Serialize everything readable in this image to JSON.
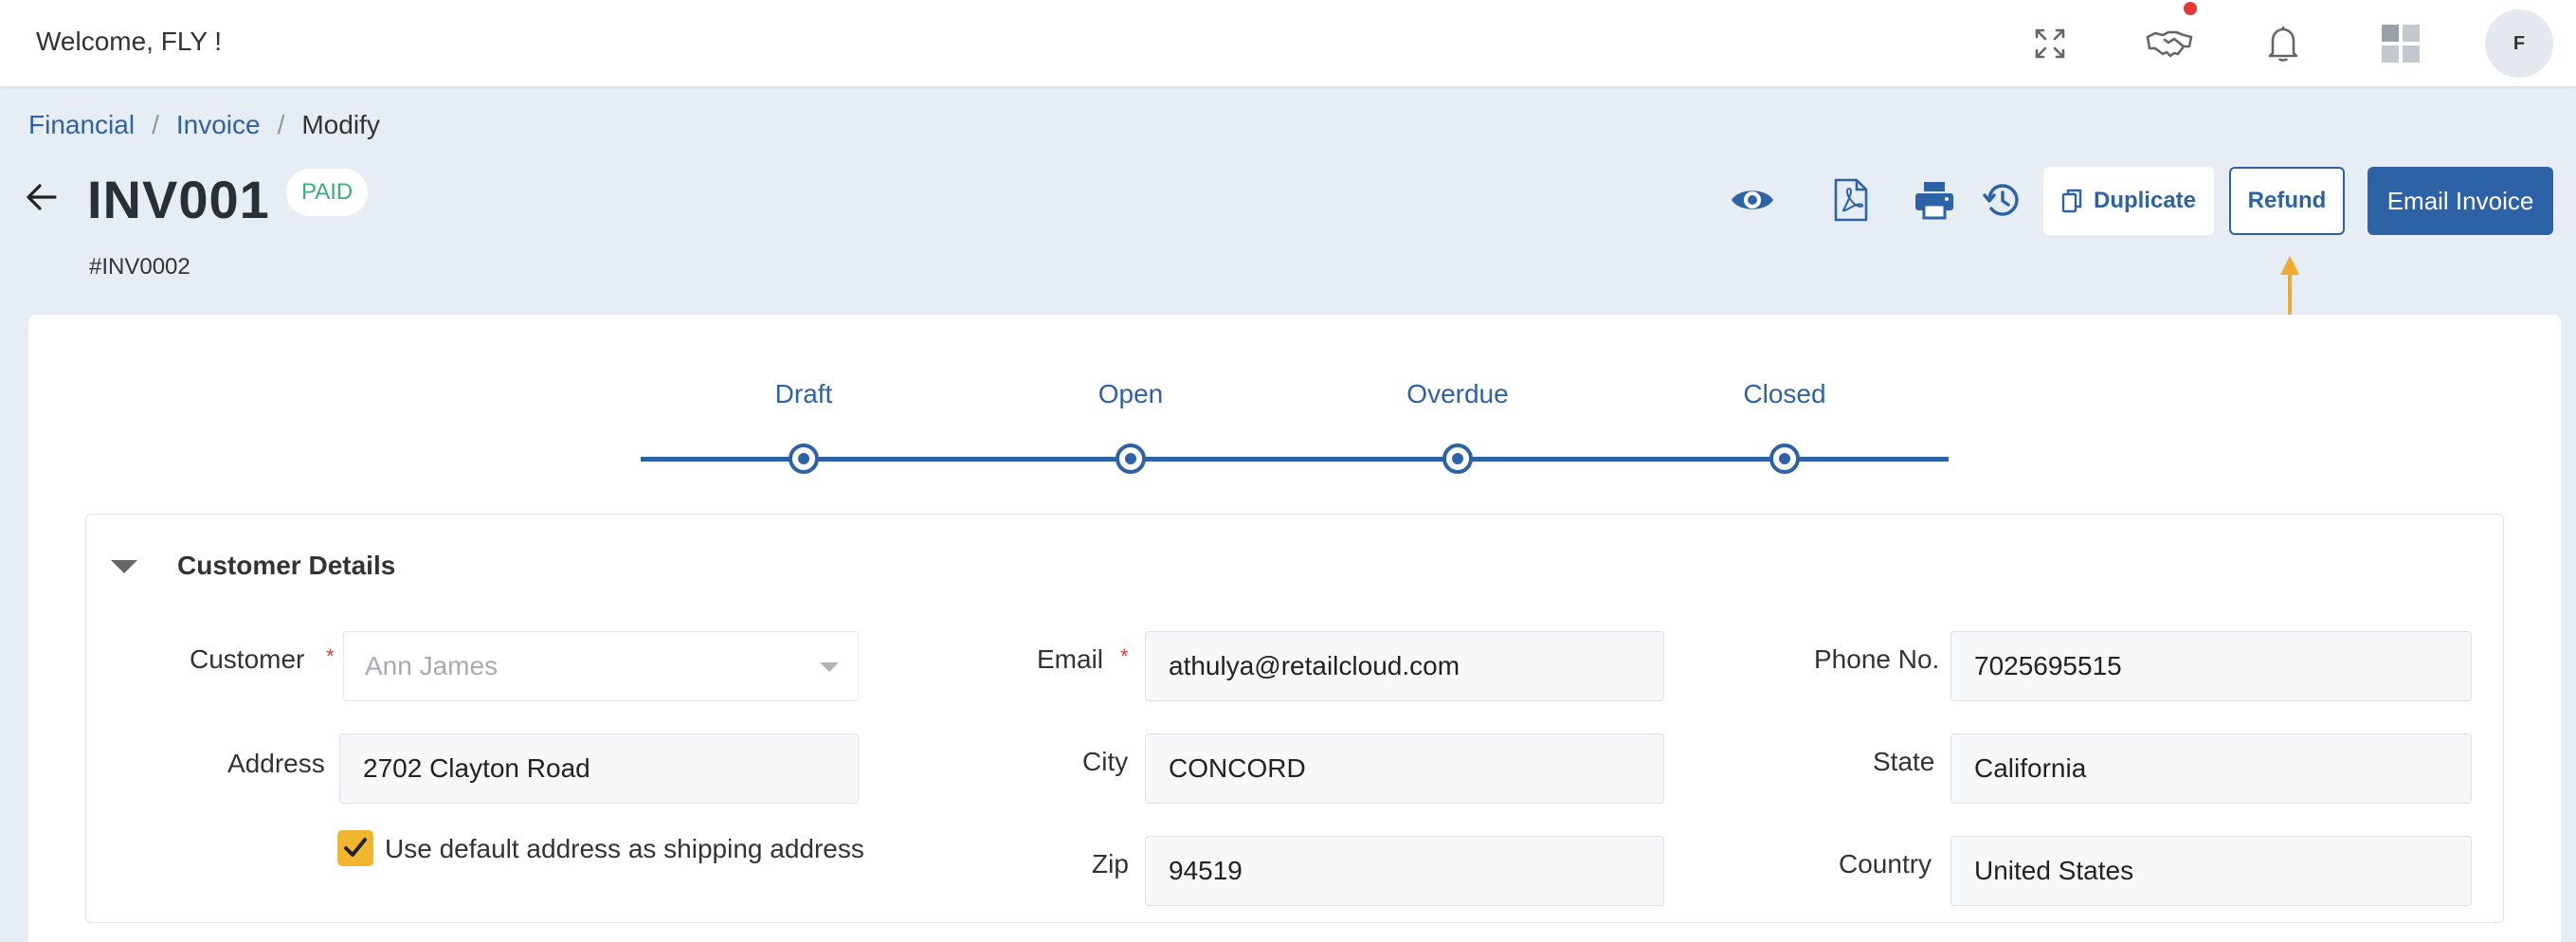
{
  "topbar": {
    "welcome": "Welcome, FLY !",
    "avatar_initial": "F",
    "icons": [
      "fullscreen-icon",
      "handshake-icon",
      "bell-icon",
      "apps-grid-icon"
    ],
    "notification_dot_color": "#e53935"
  },
  "breadcrumb": {
    "items": [
      "Financial",
      "Invoice",
      "Modify"
    ],
    "separator": "/"
  },
  "header": {
    "title": "INV001",
    "status_badge": "PAID",
    "subtitle": "#INV0002",
    "actions": {
      "icons": [
        "eye-icon",
        "pdf-icon",
        "print-icon",
        "history-icon"
      ],
      "duplicate_label": "Duplicate",
      "refund_label": "Refund",
      "email_label": "Email Invoice"
    }
  },
  "stepper": {
    "steps": [
      "Draft",
      "Open",
      "Overdue",
      "Closed"
    ]
  },
  "customer_details": {
    "title": "Customer Details",
    "fields": {
      "customer": {
        "label": "Customer",
        "value": "Ann James",
        "required": "*"
      },
      "email": {
        "label": "Email",
        "value": "athulya@retailcloud.com",
        "required": "*"
      },
      "phone": {
        "label": "Phone No.",
        "value": "7025695515"
      },
      "address": {
        "label": "Address",
        "value": "2702 Clayton Road"
      },
      "city": {
        "label": "City",
        "value": "CONCORD"
      },
      "state": {
        "label": "State",
        "value": "California"
      },
      "zip": {
        "label": "Zip",
        "value": "94519"
      },
      "country": {
        "label": "Country",
        "value": "United States"
      }
    },
    "default_shipping_label": "Use default address as shipping address",
    "default_shipping_checked": true
  },
  "colors": {
    "primary": "#2e62a6",
    "paid_green": "#3fae75",
    "checkbox_yellow": "#f1b52e",
    "annotation_arrow": "#f2a72e",
    "background": "#e6edf4"
  }
}
